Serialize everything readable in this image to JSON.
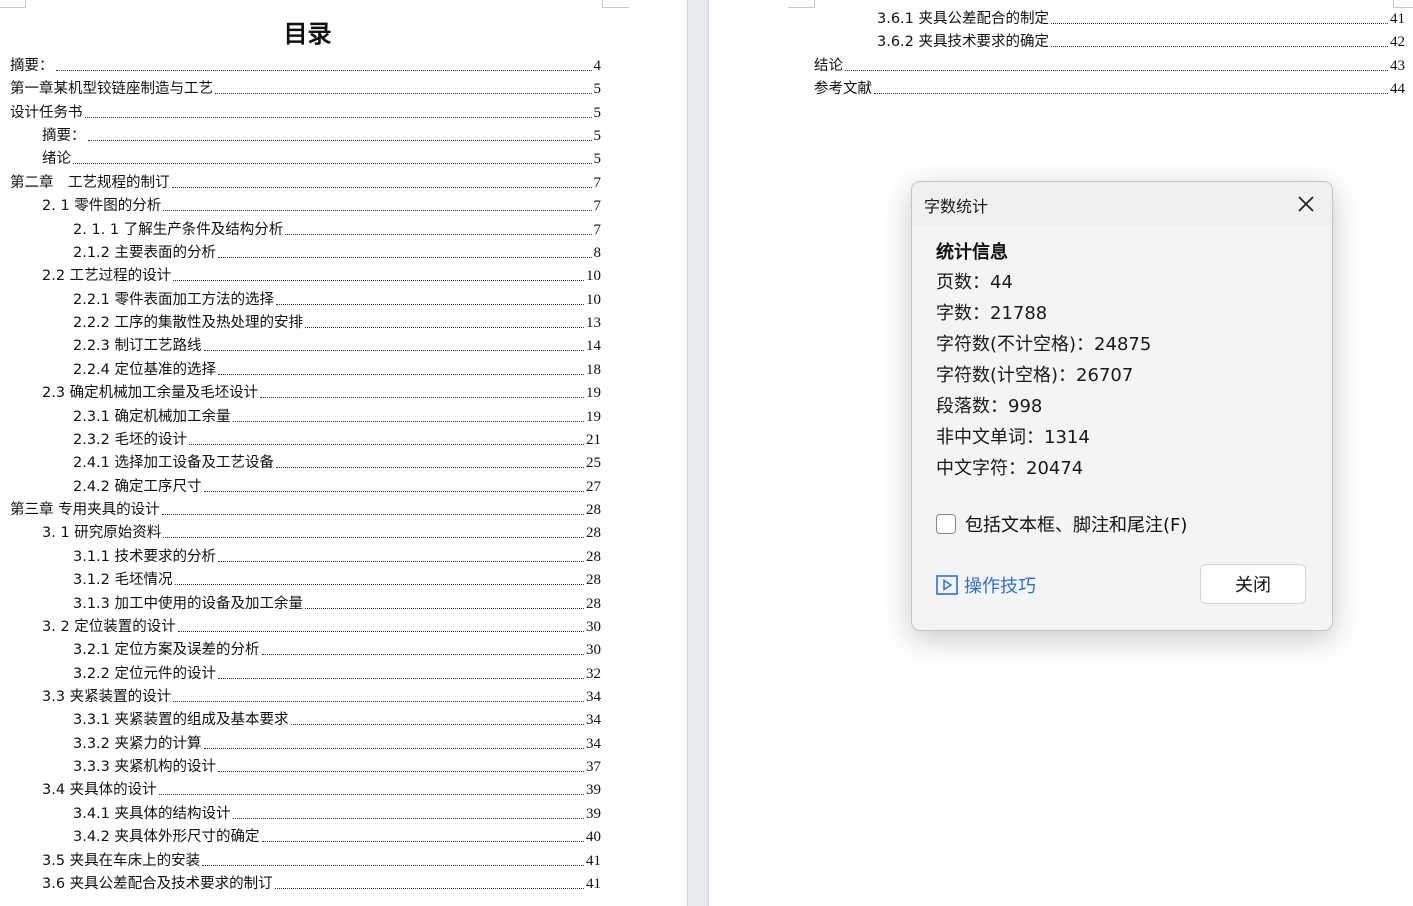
{
  "left_page": {
    "title": "目录",
    "entries": [
      {
        "label": "摘要：",
        "page": "4",
        "level": 0
      },
      {
        "label": "第一章某机型铰链座制造与工艺",
        "page": "5",
        "level": 0
      },
      {
        "label": "设计任务书",
        "page": "5",
        "level": 0
      },
      {
        "label": "摘要：",
        "page": "5",
        "level": 1
      },
      {
        "label": "绪论",
        "page": "5",
        "level": 1
      },
      {
        "label": "第二章　工艺规程的制订",
        "page": "7",
        "level": 0
      },
      {
        "label": "2. 1 零件图的分析",
        "page": "7",
        "level": 1
      },
      {
        "label": "2. 1. 1 了解生产条件及结构分析",
        "page": "7",
        "level": 2
      },
      {
        "label": "2.1.2 主要表面的分析",
        "page": "8",
        "level": 2
      },
      {
        "label": "2.2 工艺过程的设计",
        "page": "10",
        "level": 1
      },
      {
        "label": "2.2.1  零件表面加工方法的选择",
        "page": "10",
        "level": 2
      },
      {
        "label": "2.2.2  工序的集散性及热处理的安排",
        "page": "13",
        "level": 2
      },
      {
        "label": "2.2.3 制订工艺路线",
        "page": "14",
        "level": 2
      },
      {
        "label": "2.2.4  定位基准的选择",
        "page": "18",
        "level": 2
      },
      {
        "label": "2.3  确定机械加工余量及毛坯设计",
        "page": "19",
        "level": 1
      },
      {
        "label": "2.3.1  确定机械加工余量",
        "page": "19",
        "level": 2
      },
      {
        "label": "2.3.2  毛坯的设计",
        "page": "21",
        "level": 2
      },
      {
        "label": "2.4.1  选择加工设备及工艺设备",
        "page": "25",
        "level": 2
      },
      {
        "label": "2.4.2  确定工序尺寸",
        "page": "27",
        "level": 2
      },
      {
        "label": "第三章  专用夹具的设计",
        "page": "28",
        "level": 0
      },
      {
        "label": "3. 1  研究原始资料",
        "page": "28",
        "level": 1
      },
      {
        "label": "3.1.1  技术要求的分析",
        "page": "28",
        "level": 2
      },
      {
        "label": "3.1.2  毛坯情况",
        "page": "28",
        "level": 2
      },
      {
        "label": "3.1.3  加工中使用的设备及加工余量",
        "page": "28",
        "level": 2
      },
      {
        "label": "3. 2 定位装置的设计",
        "page": "30",
        "level": 1
      },
      {
        "label": "3.2.1  定位方案及误差的分析",
        "page": "30",
        "level": 2
      },
      {
        "label": "3.2.2 定位元件的设计",
        "page": "32",
        "level": 2
      },
      {
        "label": "3.3  夹紧装置的设计",
        "page": "34",
        "level": 1
      },
      {
        "label": "3.3.1  夹紧装置的组成及基本要求",
        "page": "34",
        "level": 2
      },
      {
        "label": "3.3.2  夹紧力的计算",
        "page": "34",
        "level": 2
      },
      {
        "label": "3.3.3  夹紧机构的设计",
        "page": "37",
        "level": 2
      },
      {
        "label": "3.4  夹具体的设计",
        "page": "39",
        "level": 1
      },
      {
        "label": "3.4.1  夹具体的结构设计",
        "page": "39",
        "level": 2
      },
      {
        "label": "3.4.2  夹具体外形尺寸的确定",
        "page": "40",
        "level": 2
      },
      {
        "label": "3.5 夹具在车床上的安装",
        "page": "41",
        "level": 1
      },
      {
        "label": "3.6 夹具公差配合及技术要求的制订",
        "page": "41",
        "level": 1
      }
    ]
  },
  "right_page": {
    "entries": [
      {
        "label": "3.6.1  夹具公差配合的制定",
        "page": "41",
        "level": 2
      },
      {
        "label": "3.6.2 夹具技术要求的确定",
        "page": "42",
        "level": 2
      },
      {
        "label": "结论",
        "page": "43",
        "level": 0
      },
      {
        "label": "参考文献",
        "page": "44",
        "level": 0
      }
    ]
  },
  "dialog": {
    "title": "字数统计",
    "section": "统计信息",
    "stats": [
      {
        "label": "页数：",
        "value": "44"
      },
      {
        "label": "字数：",
        "value": "21788"
      },
      {
        "label": "字符数(不计空格)：",
        "value": "24875"
      },
      {
        "label": "字符数(计空格)：",
        "value": "26707"
      },
      {
        "label": "段落数：",
        "value": "998"
      },
      {
        "label": "非中文单词：",
        "value": "1314"
      },
      {
        "label": "中文字符：",
        "value": "20474"
      }
    ],
    "checkbox_label": "包括文本框、脚注和尾注(F)",
    "checkbox_checked": false,
    "tips_label": "操作技巧",
    "close_label": "关闭",
    "link_color": "#2f6fd6"
  }
}
